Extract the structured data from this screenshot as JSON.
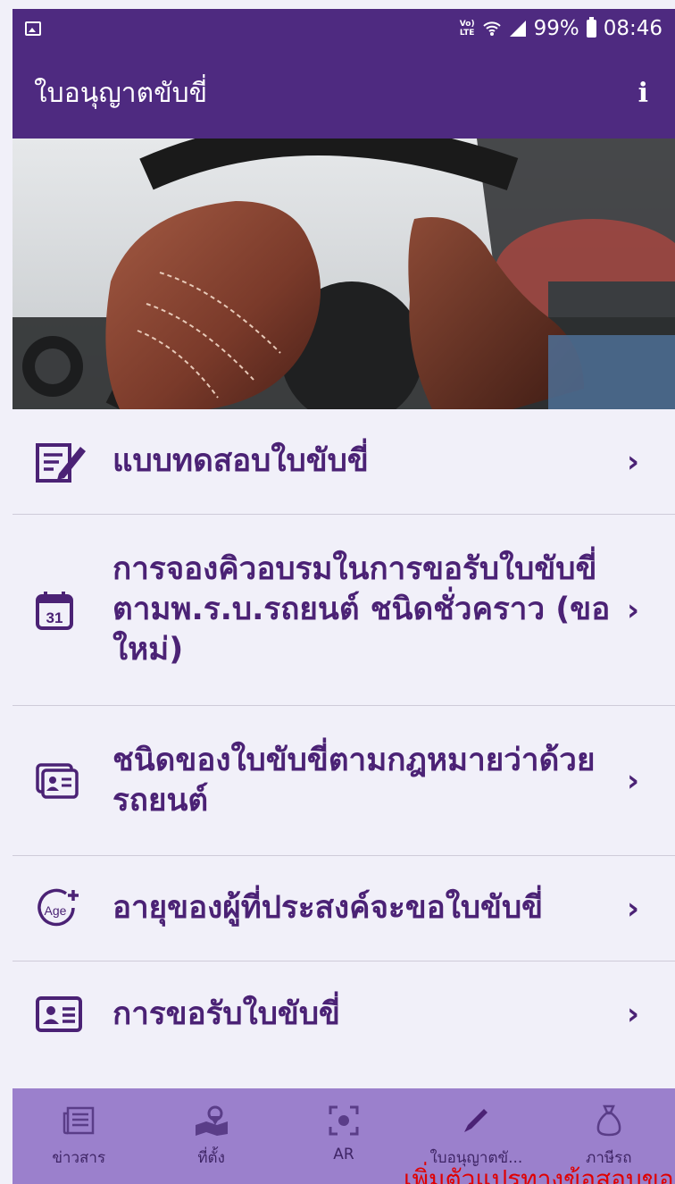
{
  "status_bar": {
    "network": "LTE",
    "battery_percent": "99%",
    "time": "08:46"
  },
  "toolbar": {
    "title": "ใบอนุญาตขับขี่",
    "info_label": "i"
  },
  "menu": {
    "items": [
      {
        "label": "แบบทดสอบใบขับขี่",
        "icon": "edit-document-icon"
      },
      {
        "label": "การจองคิวอบรมในการขอรับใบขับขี่ตามพ.ร.บ.รถยนต์ ชนิดชั่วคราว (ขอใหม่)",
        "icon": "calendar-icon",
        "icon_text": "31"
      },
      {
        "label": "ชนิดของใบขับขี่ตามกฎหมายว่าด้วยรถยนต์",
        "icon": "license-cards-icon"
      },
      {
        "label": "อายุของผู้ที่ประสงค์จะขอใบขับขี่",
        "icon": "age-plus-icon",
        "icon_text": "Age"
      },
      {
        "label": "การขอรับใบขับขี่",
        "icon": "id-card-icon"
      }
    ],
    "chevron": "›"
  },
  "bottom_nav": {
    "items": [
      {
        "label": "ข่าวสาร",
        "icon": "newspaper-icon"
      },
      {
        "label": "ที่ตั้ง",
        "icon": "map-pin-icon"
      },
      {
        "label": "AR",
        "icon": "ar-scan-icon"
      },
      {
        "label": "ใบอนุญาตขั...",
        "icon": "pencil-icon",
        "active": true
      },
      {
        "label": "ภาษีรถ",
        "icon": "money-bag-icon"
      }
    ]
  },
  "overlay_text": "เพิ่มตัวแปรทางข้อสอบขอ",
  "colors": {
    "header": "#4e2a80",
    "menu_text": "#4b2275",
    "bottom_nav": "#9b80cc",
    "background": "#f1f0f9"
  }
}
